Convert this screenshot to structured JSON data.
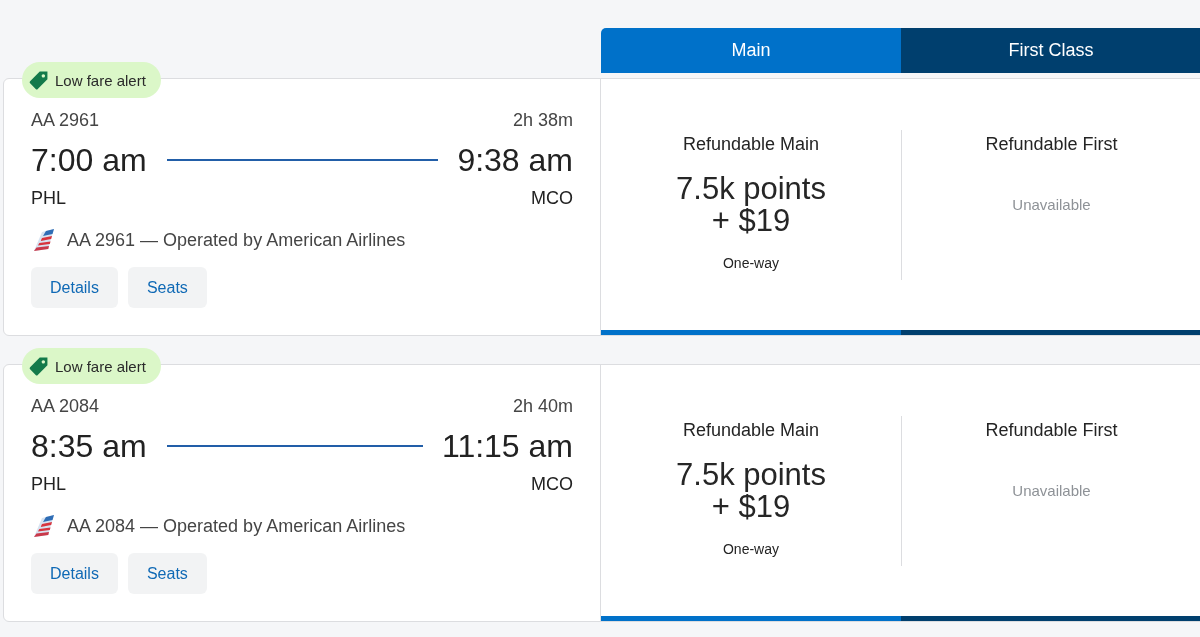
{
  "cabins": [
    {
      "label": "Main",
      "color": "#0071c9"
    },
    {
      "label": "First Class",
      "color": "#003f6e"
    }
  ],
  "flights": [
    {
      "alert": "Low fare alert",
      "flight_number": "AA 2961",
      "duration": "2h 38m",
      "depart_time": "7:00 am",
      "arrive_time": "9:38 am",
      "origin": "PHL",
      "destination": "MCO",
      "operator": "AA 2961 — Operated by American Airlines",
      "actions": [
        "Details",
        "Seats"
      ],
      "fares": [
        {
          "name": "Refundable Main",
          "available": true,
          "price": "7.5k points",
          "fee": "+ $19",
          "trip": "One-way"
        },
        {
          "name": "Refundable First",
          "available": false,
          "status": "Unavailable"
        }
      ]
    },
    {
      "alert": "Low fare alert",
      "flight_number": "AA 2084",
      "duration": "2h 40m",
      "depart_time": "8:35 am",
      "arrive_time": "11:15 am",
      "origin": "PHL",
      "destination": "MCO",
      "operator": "AA 2084 — Operated by American Airlines",
      "actions": [
        "Details",
        "Seats"
      ],
      "fares": [
        {
          "name": "Refundable Main",
          "available": true,
          "price": "7.5k points",
          "fee": "+ $19",
          "trip": "One-way"
        },
        {
          "name": "Refundable First",
          "available": false,
          "status": "Unavailable"
        }
      ]
    }
  ]
}
